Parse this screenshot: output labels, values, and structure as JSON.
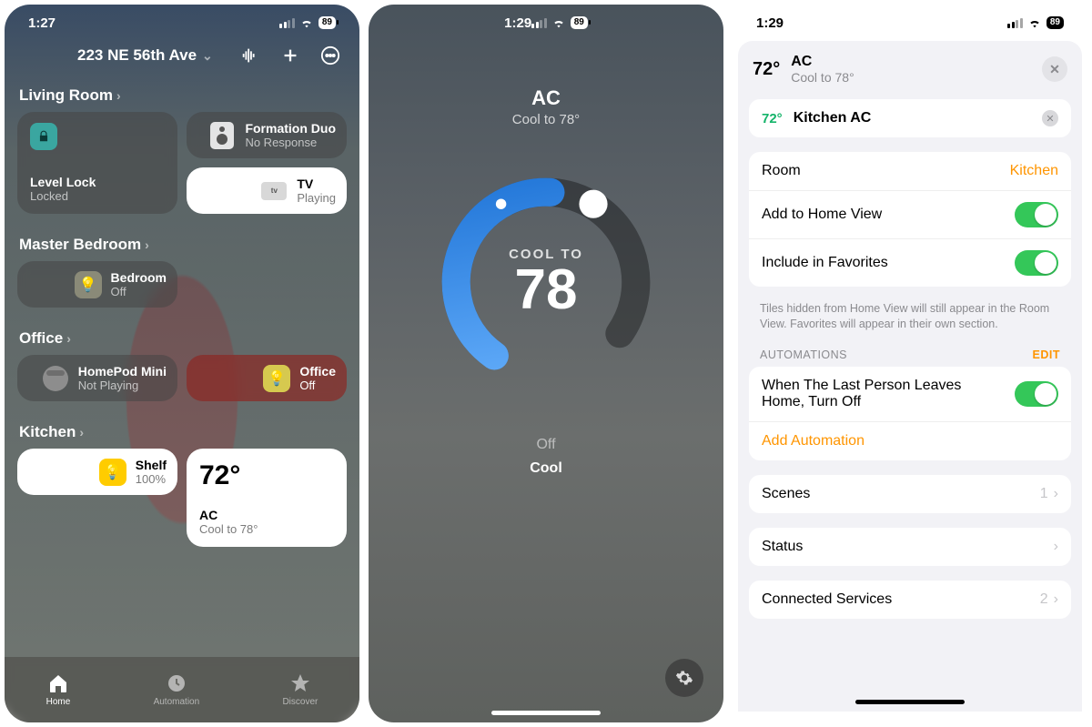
{
  "p1": {
    "status_time": "1:27",
    "battery": "89",
    "address": "223 NE 56th Ave",
    "sections": {
      "living_room": {
        "title": "Living Room",
        "lock": {
          "name": "Level Lock",
          "status": "Locked"
        },
        "duo": {
          "name": "Formation Duo",
          "status": "No Response"
        },
        "tv": {
          "name": "TV",
          "status": "Playing"
        }
      },
      "master": {
        "title": "Master Bedroom",
        "bed": {
          "name": "Bedroom",
          "status": "Off"
        }
      },
      "office": {
        "title": "Office",
        "pod": {
          "name": "HomePod Mini",
          "status": "Not Playing"
        },
        "light": {
          "name": "Office",
          "status": "Off"
        }
      },
      "kitchen": {
        "title": "Kitchen",
        "shelf": {
          "name": "Shelf",
          "status": "100%"
        },
        "ac": {
          "temp": "72°",
          "name": "AC",
          "status": "Cool to 78°"
        }
      }
    },
    "tabs": {
      "home": "Home",
      "automation": "Automation",
      "discover": "Discover"
    }
  },
  "p2": {
    "status_time": "1:29",
    "battery": "89",
    "title": "AC",
    "subtitle": "Cool to 78°",
    "dial_label": "COOL TO",
    "dial_value": "78",
    "modes": {
      "off": "Off",
      "cool": "Cool"
    }
  },
  "p3": {
    "status_time": "1:29",
    "battery": "89",
    "hdr_temp": "72°",
    "hdr_name": "AC",
    "hdr_sub": "Cool to 78°",
    "accessory_temp": "72°",
    "accessory_name": "Kitchen AC",
    "room_label": "Room",
    "room_value": "Kitchen",
    "homeview_label": "Add to Home View",
    "favorites_label": "Include in Favorites",
    "note": "Tiles hidden from Home View will still appear in the Room View. Favorites will appear in their own section.",
    "automations_header": "AUTOMATIONS",
    "automations_edit": "EDIT",
    "automation_rule": "When The Last Person Leaves Home, Turn Off",
    "add_automation": "Add Automation",
    "scenes_label": "Scenes",
    "scenes_count": "1",
    "status_label": "Status",
    "connected_label": "Connected Services",
    "connected_count": "2"
  }
}
